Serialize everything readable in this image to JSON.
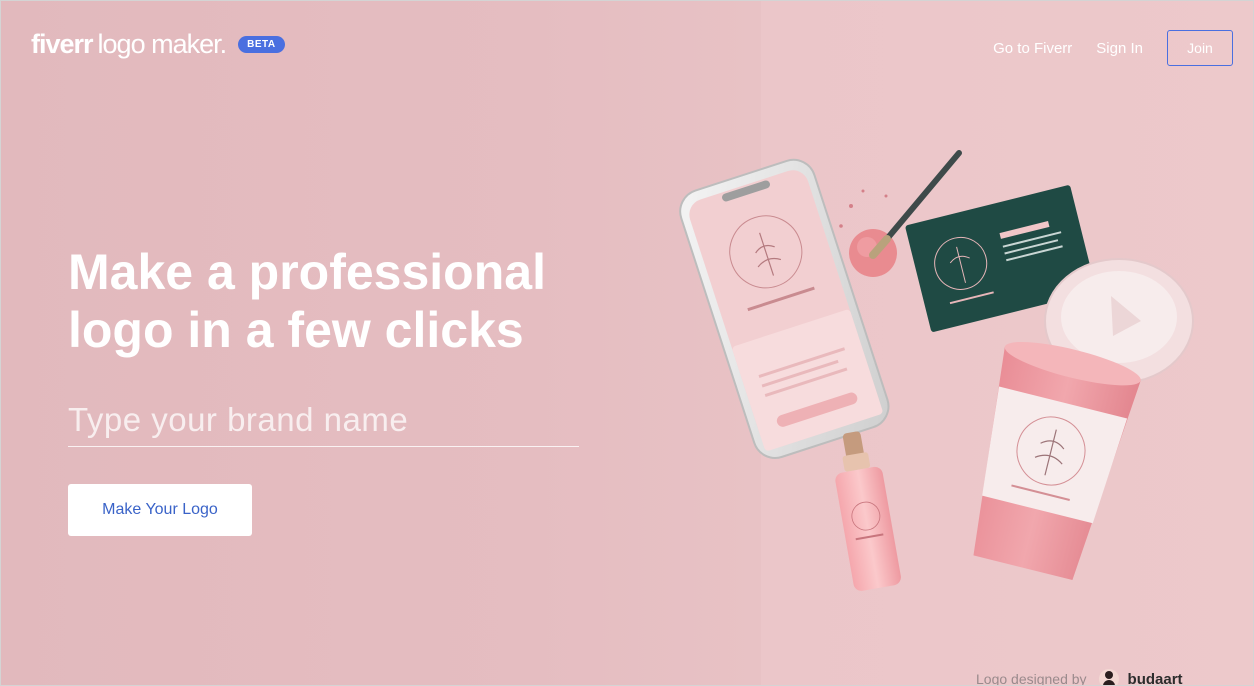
{
  "header": {
    "brand": "fiverr",
    "product": "logo maker.",
    "badge": "BETA",
    "nav": {
      "go_to_fiverr": "Go to Fiverr",
      "sign_in": "Sign In",
      "join": "Join"
    }
  },
  "hero": {
    "headline_line1": "Make a professional",
    "headline_line2": "logo in a few clicks",
    "input_placeholder": "Type your brand name",
    "cta_label": "Make Your Logo"
  },
  "credit": {
    "prefix": "Logo designed by",
    "author": "budaart"
  },
  "colors": {
    "background": "#e6bcc0",
    "accent_blue": "#4a6fe0",
    "cta_text": "#3a63c8",
    "card_green": "#1f4a44"
  },
  "icons": [
    "user-avatar-icon"
  ]
}
